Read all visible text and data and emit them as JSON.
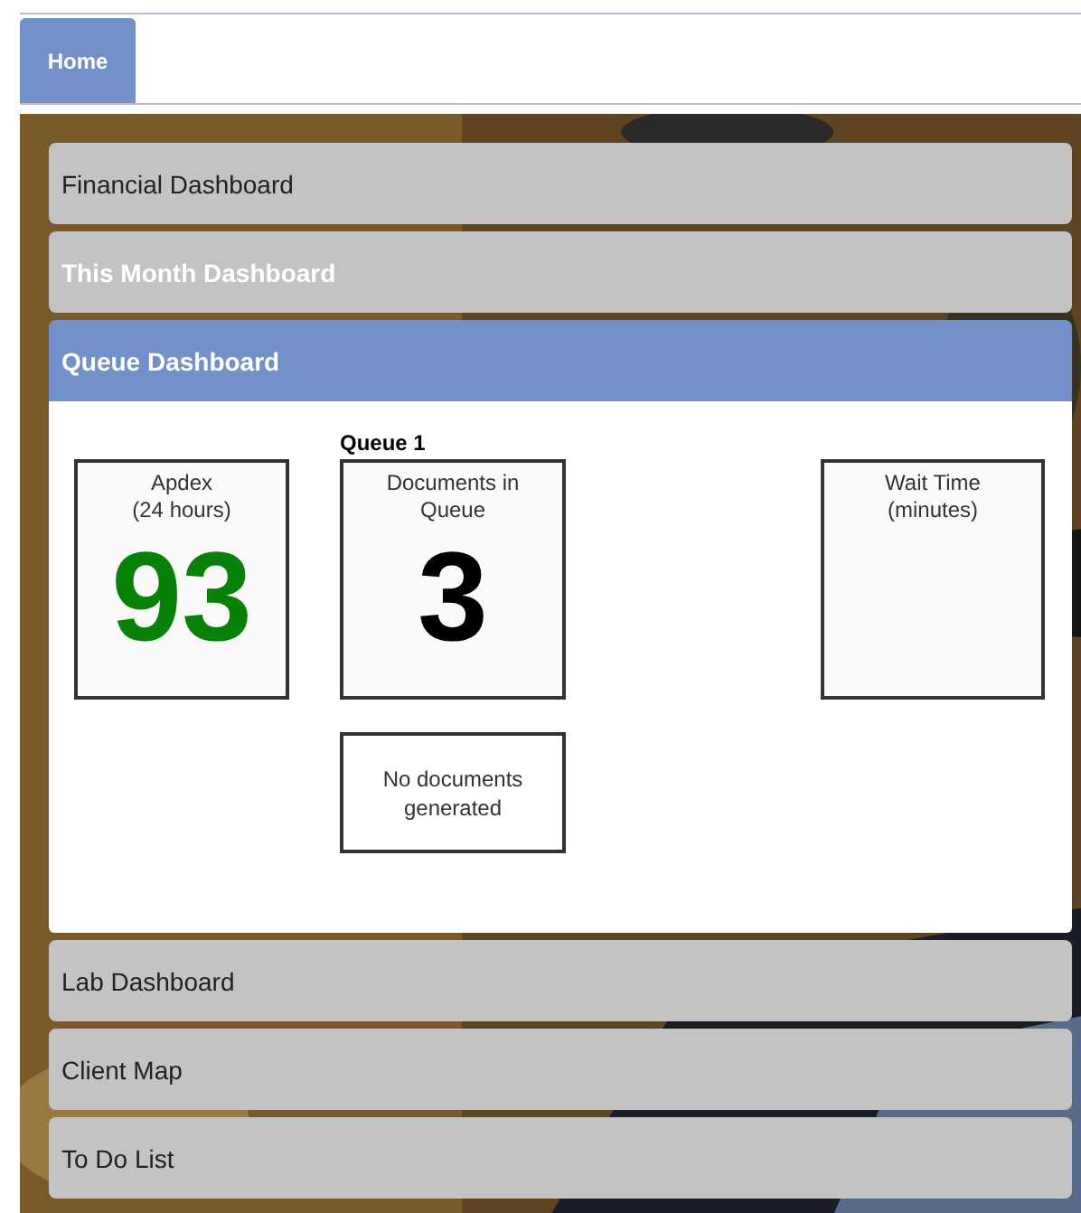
{
  "tabs": [
    {
      "label": "Home",
      "selected": true
    }
  ],
  "sections": [
    {
      "title": "Financial Dashboard",
      "expanded": false,
      "highlighted": false
    },
    {
      "title": "This Month Dashboard",
      "expanded": false,
      "highlighted": true
    },
    {
      "title": "Queue Dashboard",
      "expanded": true,
      "highlighted": false,
      "queue": {
        "title": "Queue 1",
        "metrics": [
          {
            "title": "Apdex\n(24 hours)",
            "value": "93",
            "color": "#078107"
          },
          {
            "title": "Documents in\nQueue",
            "value": "3",
            "color": "#000000"
          },
          {
            "title": "Wait Time\n(minutes)"
          }
        ],
        "note": "No documents\ngenerated"
      }
    },
    {
      "title": "Lab Dashboard",
      "expanded": false,
      "highlighted": false
    },
    {
      "title": "Client Map",
      "expanded": false,
      "highlighted": false
    },
    {
      "title": "To Do List",
      "expanded": false,
      "highlighted": false
    }
  ]
}
